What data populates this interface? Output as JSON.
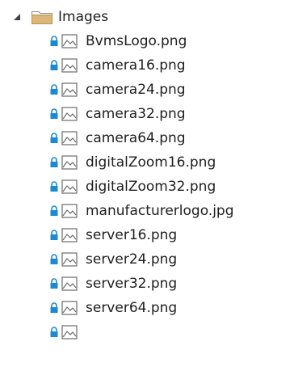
{
  "folder": {
    "label": "Images",
    "expanded": true
  },
  "files": [
    {
      "label": "BvmsLogo.png"
    },
    {
      "label": "camera16.png"
    },
    {
      "label": "camera24.png"
    },
    {
      "label": "camera32.png"
    },
    {
      "label": "camera64.png"
    },
    {
      "label": "digitalZoom16.png"
    },
    {
      "label": "digitalZoom32.png"
    },
    {
      "label": "manufacturerlogo.jpg"
    },
    {
      "label": "server16.png"
    },
    {
      "label": "server24.png"
    },
    {
      "label": "server32.png"
    },
    {
      "label": "server64.png"
    },
    {
      "label": ""
    }
  ],
  "colors": {
    "lock": "#1a8ad4",
    "folder": "#dcb67a",
    "image_icon": "#6b6b6b",
    "expander": "#404040"
  },
  "icons": {
    "expander": "expanded-triangle-icon",
    "folder": "folder-icon",
    "lock": "lock-icon",
    "file": "image-file-icon"
  }
}
